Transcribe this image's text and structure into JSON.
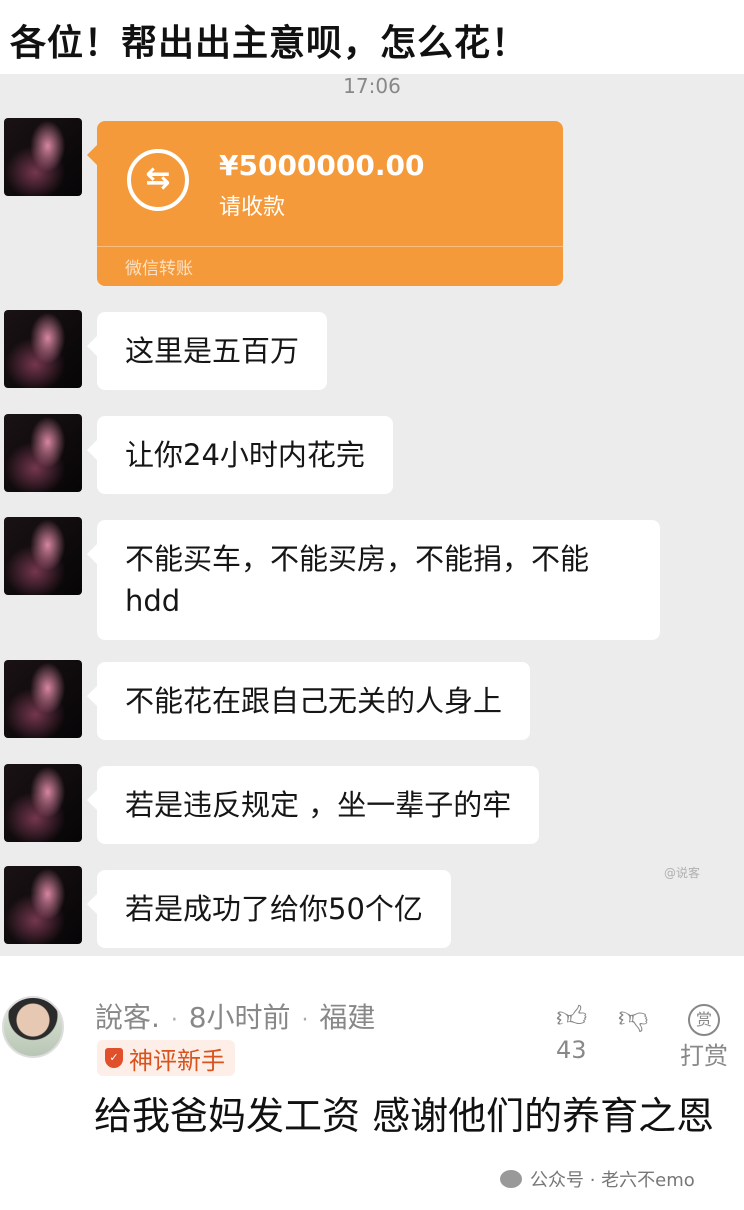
{
  "post": {
    "title": "各位！帮出出主意呗，怎么花！"
  },
  "chat": {
    "time": "17:06",
    "transfer": {
      "amount": "¥5000000.00",
      "note": "请收款",
      "footer": "微信转账",
      "color": "#f59a3b"
    },
    "messages": [
      {
        "text": "这里是五百万"
      },
      {
        "text": "让你24小时内花完"
      },
      {
        "text": "不能买车，不能买房，不能捐，不能hdd"
      },
      {
        "text": "不能花在跟自己无关的人身上"
      },
      {
        "text": "若是违反规定 ，坐一辈子的牢"
      },
      {
        "text": "若是成功了给你50个亿"
      }
    ],
    "watermark": "@说客"
  },
  "comment": {
    "username": "說客.",
    "time_ago": "8小时前",
    "location": "福建",
    "badge": "神评新手",
    "likes": "43",
    "tip_label": "打赏",
    "tip_icon_char": "赏",
    "text": "给我爸妈发工资 感谢他们的养育之恩"
  },
  "footer_watermark": "公众号 · 老六不emo"
}
